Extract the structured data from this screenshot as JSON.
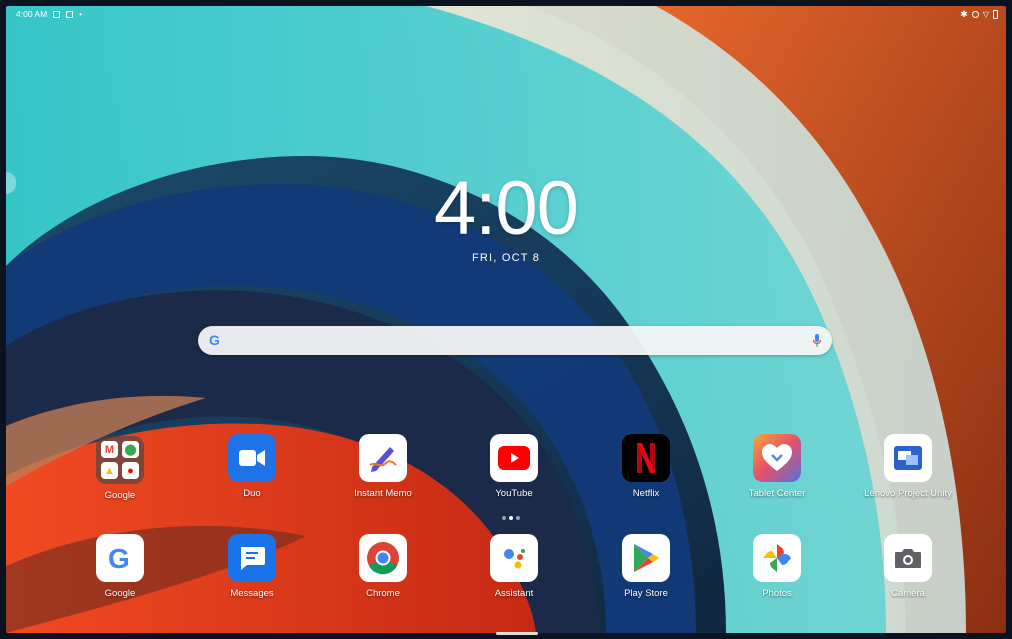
{
  "status_bar": {
    "time": "4:00 AM",
    "left_icons": [
      "notification-icon-1",
      "notification-icon-2",
      "dot-icon"
    ],
    "right_icons": [
      "bluetooth-icon",
      "dnd-icon",
      "wifi-icon",
      "battery-icon"
    ]
  },
  "clock": {
    "time": "4:00",
    "date": "FRI, OCT 8"
  },
  "search": {
    "logo": "G",
    "icon_left": "google-g-icon",
    "icon_right": "mic-icon"
  },
  "row1": [
    {
      "label": "Google",
      "icon": "google-folder-icon"
    },
    {
      "label": "Duo",
      "icon": "duo-icon"
    },
    {
      "label": "Instant Memo",
      "icon": "instant-memo-icon"
    },
    {
      "label": "YouTube",
      "icon": "youtube-icon"
    },
    {
      "label": "Netflix",
      "icon": "netflix-icon"
    },
    {
      "label": "Tablet Center",
      "icon": "tablet-center-icon"
    },
    {
      "label": "Lenovo Project Unity",
      "icon": "lenovo-project-unity-icon"
    }
  ],
  "dock": [
    {
      "label": "Google",
      "icon": "google-icon"
    },
    {
      "label": "Messages",
      "icon": "messages-icon"
    },
    {
      "label": "Chrome",
      "icon": "chrome-icon"
    },
    {
      "label": "Assistant",
      "icon": "assistant-icon"
    },
    {
      "label": "Play Store",
      "icon": "play-store-icon"
    },
    {
      "label": "Photos",
      "icon": "photos-icon"
    },
    {
      "label": "Camera",
      "icon": "camera-icon"
    }
  ],
  "page_indicator": {
    "pages": 3,
    "current": 1
  },
  "colors": {
    "accent_red": "#E50914",
    "duo_blue": "#1E73E8",
    "youtube_red": "#FF0000"
  }
}
